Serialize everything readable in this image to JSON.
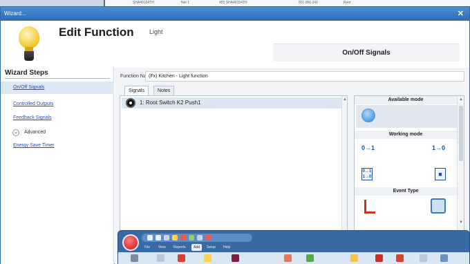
{
  "background_window": {
    "row": [
      "SHA49154TH",
      "Net 1",
      "455 SHA49154TH",
      "001.056.242",
      "Root"
    ]
  },
  "wizard": {
    "window_title": "Wizard...",
    "close_glyph": "✕",
    "header": {
      "title": "Edit Function",
      "subtitle": "Light",
      "section": "On/Off Signals",
      "icon": "light-bulb-icon"
    },
    "sidebar": {
      "title": "Wizard Steps",
      "steps": [
        "On/Off Signals",
        "Controlled Outputs",
        "Feedback Signals"
      ],
      "advanced_icon": "⌄",
      "advanced": "Advanced",
      "energy": "Energy Save Timer"
    },
    "function_name_label": "Function Name",
    "function_name_value": "(Fx) Kitchen - Light function",
    "tabs": [
      "Signals",
      "Notes"
    ],
    "signals": [
      "1: Root Switch K2 Push1"
    ],
    "modes": {
      "available_title": "Available mode",
      "working_title": "Working mode",
      "working_on": "0→1",
      "working_off": "1→0",
      "working_toggle_top": "0→1",
      "working_toggle_bottom": "1→0",
      "event_title": "Event Type"
    }
  },
  "app": {
    "menu": [
      "File",
      "View",
      "Reports",
      "Add",
      "Setup",
      "Help"
    ],
    "selected_menu": "Add",
    "accent": "#3a6aa6"
  }
}
